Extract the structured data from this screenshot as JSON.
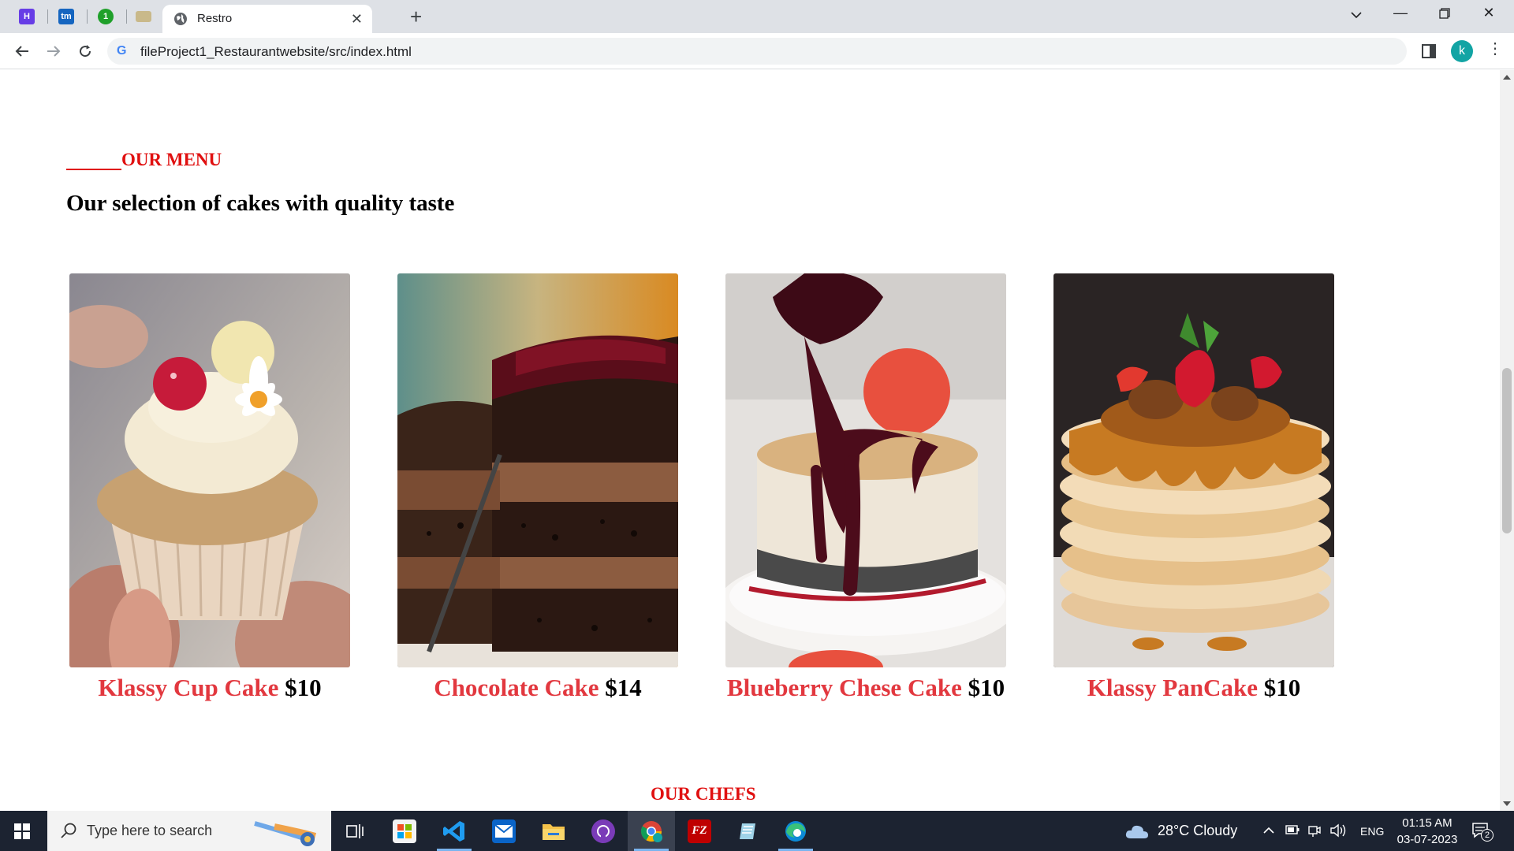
{
  "browser": {
    "tab_title": "Restro",
    "url": "fileProject1_Restaurantwebsite/src/index.html",
    "profile_initial": "k",
    "pinned_tabs": [
      {
        "icon": "hostinger-icon",
        "label": "H",
        "color": "#673de6"
      },
      {
        "icon": "tm-icon",
        "label": "tm",
        "color": "#1565c0"
      },
      {
        "icon": "one-icon",
        "label": "1",
        "color": "#1fa02a"
      },
      {
        "icon": "mail-icon",
        "label": "",
        "color": "#c9b98a"
      }
    ]
  },
  "menu_section": {
    "eyebrow": "OUR MENU",
    "heading": "Our selection of cakes with quality taste",
    "items": [
      {
        "name": "Klassy Cup Cake",
        "price": "$10"
      },
      {
        "name": "Chocolate Cake",
        "price": "$14"
      },
      {
        "name": "Blueberry Chese Cake",
        "price": "$10"
      },
      {
        "name": "Klassy PanCake",
        "price": "$10"
      }
    ]
  },
  "chefs_section": {
    "eyebrow": "OUR CHEFS"
  },
  "taskbar": {
    "search_placeholder": "Type here to search",
    "weather": "28°C  Cloudy",
    "language": "ENG",
    "time": "01:15 AM",
    "date": "03-07-2023",
    "notification_count": "2"
  },
  "colors": {
    "accent_red": "#e01010",
    "item_name_red": "#e2383f",
    "taskbar_bg": "#1c2331"
  }
}
